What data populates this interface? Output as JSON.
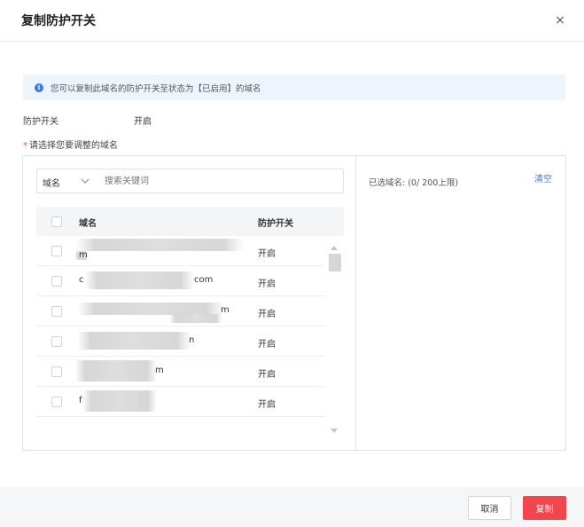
{
  "dialog": {
    "title": "复制防护开关",
    "close_glyph": "×",
    "close_icon": "close-icon"
  },
  "notice": {
    "icon": "info-icon",
    "icon_glyph": "i",
    "text": "您可以复制此域名的防护开关至状态为【已启用】的域名",
    "background": "#eef4fc",
    "icon_color": "#3f79e8"
  },
  "protection_switch": {
    "label": "防护开关",
    "value": "开启"
  },
  "domain_selection": {
    "required_mark": "*",
    "label": "请选择您要调整的域名",
    "search": {
      "filter_value": "域名",
      "placeholder": "搜索关键词",
      "value": ""
    },
    "table": {
      "columns": [
        "域名",
        "防护开关"
      ],
      "rows": [
        {
          "domain_prefix": "",
          "domain_suffix": "m",
          "switch": "开启"
        },
        {
          "domain_prefix": "c",
          "domain_suffix": "com",
          "switch": "开启"
        },
        {
          "domain_prefix": "",
          "domain_suffix": "m",
          "switch": "开启"
        },
        {
          "domain_prefix": "",
          "domain_suffix": "n",
          "switch": "开启"
        },
        {
          "domain_prefix": "",
          "domain_suffix": "m",
          "switch": "开启"
        },
        {
          "domain_prefix": "f",
          "domain_suffix": "",
          "switch": "开启"
        }
      ]
    },
    "selected_summary": "已选域名: (0/ 200上限)",
    "clear_label": "清空"
  },
  "footer": {
    "cancel_label": "取消",
    "confirm_label": "复制",
    "confirm_color": "#f0464c"
  }
}
